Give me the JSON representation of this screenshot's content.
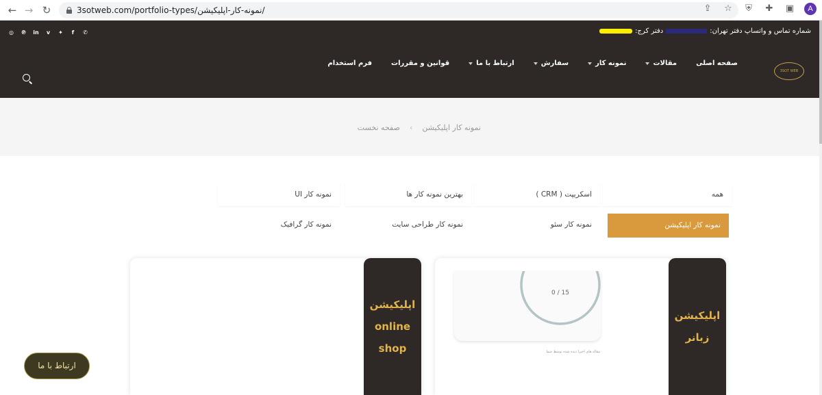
{
  "browser": {
    "url": "3sotweb.com/portfolio-types/نمونه-کار-اپلیکیشن/",
    "profile_initial": "A"
  },
  "header": {
    "contact_text": "شماره تماس و واتساپ دفتر تهران:",
    "contact_text_2": "دفتر کرج:",
    "logo_text": "3SOT WEB",
    "nav": [
      {
        "label": "صفحه اصلی",
        "dropdown": false
      },
      {
        "label": "مقالات",
        "dropdown": true
      },
      {
        "label": "نمونه کار",
        "dropdown": true
      },
      {
        "label": "سفارش",
        "dropdown": true
      },
      {
        "label": "ارتباط با ما",
        "dropdown": true
      },
      {
        "label": "قوانین و مقررات",
        "dropdown": false
      },
      {
        "label": "فرم استخدام",
        "dropdown": false
      }
    ],
    "socials": [
      "whatsapp-icon",
      "facebook-icon",
      "twitter-icon",
      "vimeo-icon",
      "linkedin-icon",
      "pinterest-icon",
      "instagram-icon"
    ]
  },
  "breadcrumb": {
    "home": "صفحه نخست",
    "separator": "›",
    "current": "نمونه کار اپلیکیشن"
  },
  "filters": {
    "all": "همه",
    "crm": "اسکریپت ( CRM )",
    "best": "بهترین نمونه کار ها",
    "ui": "نمونه کار UI",
    "app": "نمونه کار اپلیکیشن",
    "seo": "نمونه کار سئو",
    "site": "نمونه کار طراحی سایت",
    "graphic": "نمونه کار گرافیک"
  },
  "cards": [
    {
      "title_line1": "اپلیکیشن",
      "title_line2": "زبانر",
      "progress": "0 / 15",
      "progress_fraction": 0,
      "caption": "مقاله های اخیرا دیده شده توسط شما"
    },
    {
      "title_line1": "اپلیکیشن",
      "title_line2": "online",
      "title_line3": "shop"
    }
  ],
  "contact_button": "ارتباط با ما",
  "colors": {
    "header_bg": "#2e2927",
    "accent": "#d99a3e",
    "title_gold": "#e2b34a"
  }
}
